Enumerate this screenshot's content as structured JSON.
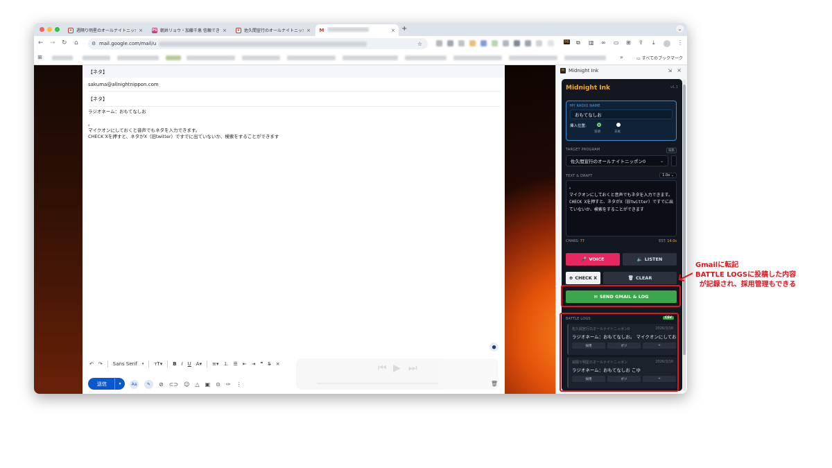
{
  "browser": {
    "tabs": [
      {
        "title": "週隔り明星のオールナイトニッポン",
        "favicon": "ann-icon",
        "active": false
      },
      {
        "title": "朝井リョウ・加藤千恵 信頼できる",
        "favicon": "ps-icon",
        "favicon_text": "PS",
        "active": false
      },
      {
        "title": "佐久間宣行のオールナイトニッポン",
        "favicon": "ann-icon",
        "active": false
      },
      {
        "title": "",
        "favicon": "gmail-icon",
        "active": true
      }
    ],
    "url": "mail.google.com/mail/u",
    "bookmarks_all_label": "すべてのブックマーク",
    "toolbar_more": "»"
  },
  "compose": {
    "rows": [
      "【ネタ】",
      "sakuma@allnightnippon.com",
      "【ネタ】"
    ],
    "body_lines": [
      "ラジオネーム：おもてなしお",
      "",
      "。",
      "マイクオンにしておくと音声でもネタを入力できます。",
      "CHECK Xを押すと、ネタがX（旧twitter）ですでに出ていないか、検索をすることができます"
    ],
    "toolbar": {
      "font": "Sans Serif"
    },
    "send_label": "送信",
    "aa_label": "Aa"
  },
  "extension": {
    "panel_title": "Midnight Ink",
    "app_title": "Midnight Ink",
    "version": "v1.1",
    "radio_name_label": "MY RADIO NAME",
    "radio_name_value": "おもてなしお",
    "insert_position_label": "挿入位置:",
    "insert_options": [
      "冒頭",
      "末尾"
    ],
    "insert_selected": "冒頭",
    "target_program_label": "TARGET PROGRAM",
    "target_program_badge": "編集",
    "target_program_value": "佐久間宣行のオールナイトニッポン0",
    "text_draft_label": "TEXT & DRAFT",
    "speed_value": "1.0x",
    "draft_text": "。\nマイクオンにしておくと音声でもネタを入力できます。\nCHECK Xを押すと、ネタがX（旧twitter）ですでに出ていないか、検索をすることができます",
    "chars_label": "CHARS:",
    "chars_value": "77",
    "est_label": "EST:",
    "est_value": "14.0s",
    "voice_label": "VOICE",
    "listen_label": "LISTEN",
    "checkx_label": "CHECK X",
    "clear_label": "CLEAR",
    "send_label": "SEND GMAIL & LOG",
    "battle_logs_label": "BATTLE LOGS",
    "csv_label": "CSV",
    "logs": [
      {
        "program": "佐久間宣行のオールナイトニッポン0",
        "date": "2026/3/16",
        "text": "ラジオネーム：おもてなしお。 マイクオンにしてお...",
        "buttons": [
          "採用",
          "ボツ",
          "+"
        ]
      },
      {
        "program": "週隔り明星のオールナイトニッポン",
        "date": "2026/3/16",
        "text": "ラジオネーム：おもてなしお こゆ",
        "buttons": [
          "採用",
          "ボツ",
          "+"
        ]
      }
    ],
    "colors": {
      "accent": "#f7a531",
      "voice": "#e8265f",
      "send": "#3ba64a",
      "highlight": "#e3131b"
    }
  },
  "annotation": {
    "lines": [
      "Gmailに転記",
      "BATTLE LOGSに投稿した内容",
      "が記録され、採用管理もできる"
    ],
    "color": "#e3131b"
  }
}
